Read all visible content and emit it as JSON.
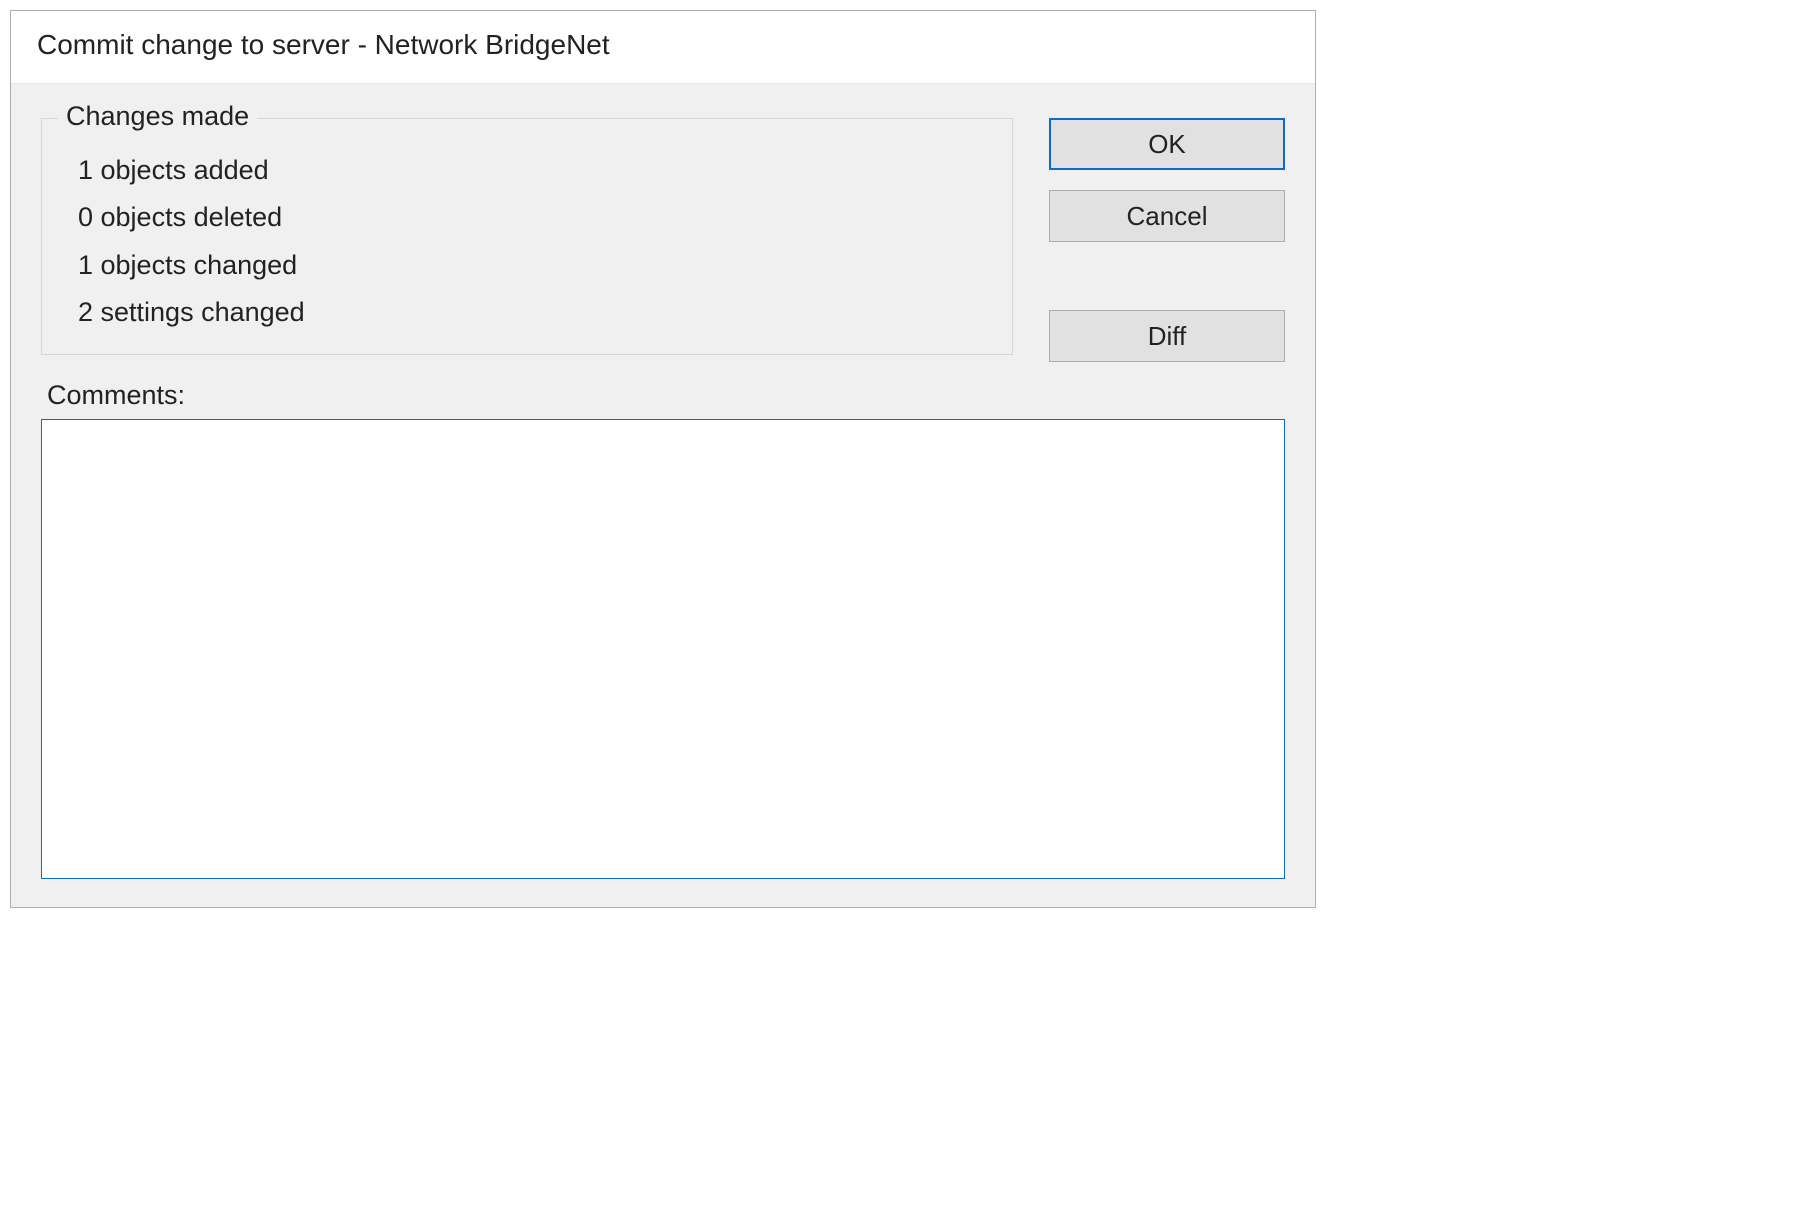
{
  "dialog": {
    "title": "Commit change to server - Network BridgeNet"
  },
  "changes": {
    "legend": "Changes made",
    "items": [
      "1 objects added",
      "0 objects deleted",
      "1 objects changed",
      "2 settings changed"
    ]
  },
  "buttons": {
    "ok": "OK",
    "cancel": "Cancel",
    "diff": "Diff"
  },
  "comments": {
    "label": "Comments:",
    "value": ""
  }
}
